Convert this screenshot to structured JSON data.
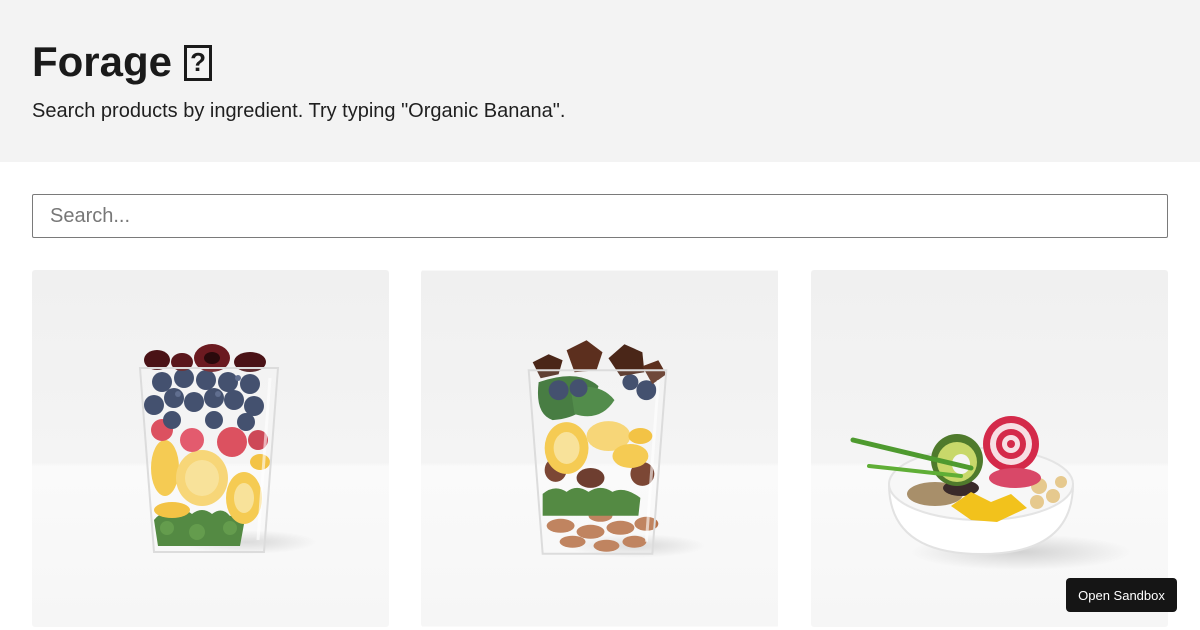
{
  "header": {
    "title": "Forage",
    "title_glyph_icon": "missing-glyph-icon",
    "subtitle": "Search products by ingredient. Try typing \"Organic Banana\"."
  },
  "search": {
    "placeholder": "Search...",
    "value": ""
  },
  "products": [
    {
      "image": "berry-banana-kale-smoothie-cup"
    },
    {
      "image": "chocolate-spinach-almond-smoothie-cup"
    },
    {
      "image": "avocado-beet-harvest-bowl"
    }
  ],
  "sandbox": {
    "label": "Open Sandbox"
  },
  "colors": {
    "header_bg": "#f3f3f3",
    "card_bg": "#f1f1f1",
    "button_bg": "#151515"
  }
}
